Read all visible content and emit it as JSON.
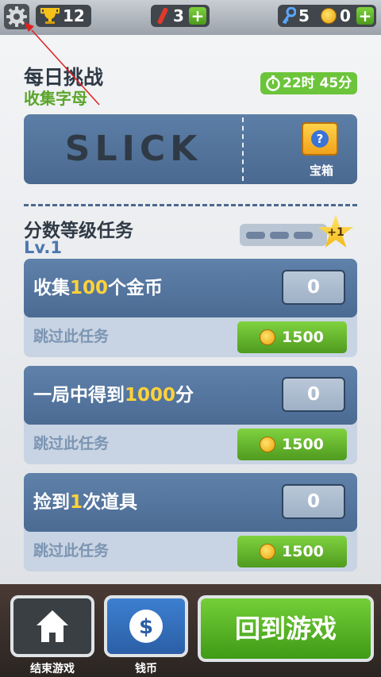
{
  "topbar": {
    "trophy_count": "12",
    "boards_count": "3",
    "keys_count": "5",
    "coins_count": "0",
    "plus": "+"
  },
  "daily": {
    "title": "每日挑战",
    "subtitle": "收集字母",
    "timer": "22时 45分",
    "word": "SLICK",
    "chest_label": "宝箱"
  },
  "score": {
    "title": "分数等级任务",
    "level": "Lv.1",
    "star_bonus": "+1"
  },
  "missions": [
    {
      "pre": "收集",
      "highlight": "100",
      "post": "个金币",
      "progress": "0",
      "skip": "跳过此任务",
      "cost": "1500"
    },
    {
      "pre": "一局中得到",
      "highlight": "1000",
      "post": "分",
      "progress": "0",
      "skip": "跳过此任务",
      "cost": "1500"
    },
    {
      "pre": "捡到",
      "highlight": "1",
      "post": "次道具",
      "progress": "0",
      "skip": "跳过此任务",
      "cost": "1500"
    }
  ],
  "bottom": {
    "end_game_label": "结束游戏",
    "coins_label": "钱币",
    "back_to_game": "回到游戏"
  },
  "colors": {
    "green": "#6cc43a",
    "blue_card": "#4a6990",
    "highlight_yellow": "#ffd23a"
  },
  "icons": [
    "gear-icon",
    "trophy-icon",
    "hoverboard-icon",
    "key-icon",
    "coin-icon",
    "timer-icon",
    "mystery-box-icon",
    "star-icon",
    "home-icon",
    "dollar-icon"
  ]
}
